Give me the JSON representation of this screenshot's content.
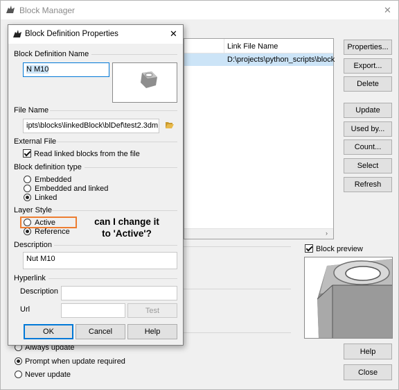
{
  "block_manager": {
    "title": "Block Manager",
    "close_glyph": "✕",
    "table": {
      "col_link_file_name": "Link File Name",
      "row_link_value": "D:\\projects\\python_scripts\\block"
    },
    "buttons": {
      "properties": "Properties...",
      "export": "Export...",
      "delete": "Delete",
      "update": "Update",
      "used_by": "Used by...",
      "count": "Count...",
      "select": "Select",
      "refresh": "Refresh",
      "help": "Help",
      "close": "Close"
    },
    "block_preview_label": "Block preview",
    "block_preview_checked": true,
    "update_options": [
      "Always update",
      "Prompt when update required",
      "Never update"
    ],
    "update_selected": "Prompt when update required"
  },
  "dialog": {
    "title": "Block Definition Properties",
    "close_glyph": "✕",
    "block_definition_name_label": "Block Definition Name",
    "block_definition_name_value": "N M10",
    "file_name_label": "File Name",
    "file_name_value": "ipts\\blocks\\linkedBlock\\blDef\\test2.3dm",
    "folder_icon": "folder-open-icon",
    "external_file_label": "External File",
    "read_linked_label": "Read linked blocks from the file",
    "read_linked_checked": true,
    "block_def_type_label": "Block definition type",
    "block_def_types": [
      "Embedded",
      "Embedded and linked",
      "Linked"
    ],
    "block_def_type_selected": "Linked",
    "layer_style_label": "Layer Style",
    "layer_styles": [
      "Active",
      "Reference"
    ],
    "layer_style_selected": "Reference",
    "description_label": "Description",
    "description_value": "Nut M10",
    "hyperlink_label": "Hyperlink",
    "hyperlink_description_label": "Description",
    "hyperlink_description_value": "",
    "url_label": "Url",
    "url_value": "",
    "test_button": "Test",
    "ok_button": "OK",
    "cancel_button": "Cancel",
    "help_button": "Help"
  },
  "annotation": {
    "line1": "can I change it",
    "line2": "to 'Active'?",
    "highlight_color": "#ed7d31"
  },
  "colors": {
    "window_bg": "#f0f0f0",
    "accent": "#0078d7",
    "selection": "#cce4f7"
  }
}
